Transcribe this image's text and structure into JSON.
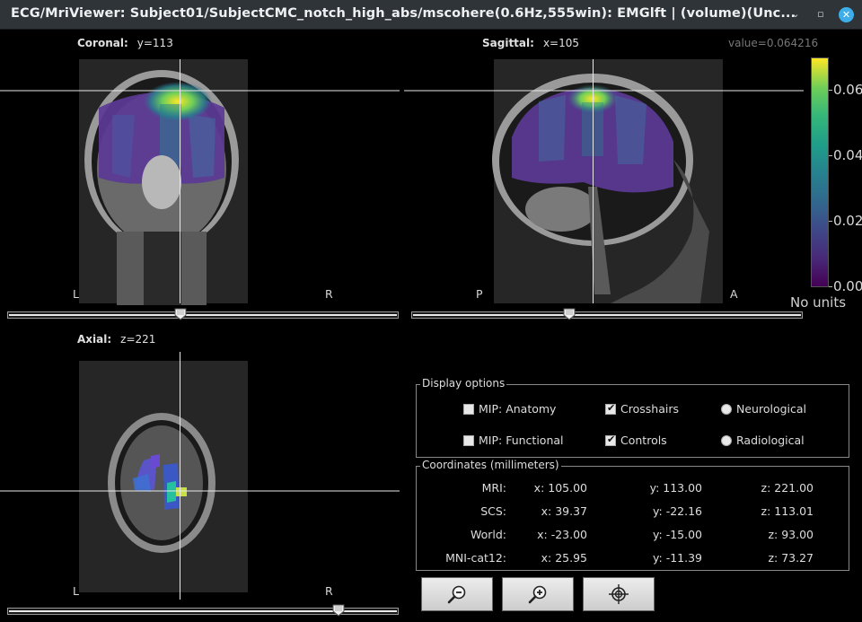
{
  "window": {
    "title": "ECG/MriViewer: Subject01/SubjectCMC_notch_high_abs/mscohere(0.6Hz,555win): EMGlft | (volume)(Unc...",
    "minimize_glyph": "⌄",
    "maximize_glyph": "▫",
    "close_glyph": "✕"
  },
  "views": {
    "coronal": {
      "name": "Coronal:",
      "coord": "y=113",
      "left": "L",
      "right": "R",
      "slider_value": 0.44
    },
    "sagittal": {
      "name": "Sagittal:",
      "coord": "x=105",
      "left": "P",
      "right": "A",
      "slider_value": 0.4
    },
    "axial": {
      "name": "Axial:",
      "coord": "z=221",
      "left": "L",
      "right": "R",
      "slider_value": 0.86
    }
  },
  "value_readout": "value=0.064216",
  "colorbar": {
    "ticks": [
      "0.06",
      "0.04",
      "0.02",
      "0.00"
    ],
    "units": "No units",
    "colors": [
      "#440154",
      "#3e4989",
      "#26828e",
      "#35b779",
      "#fde725"
    ]
  },
  "display_options": {
    "title": "Display options",
    "mip_anatomy": {
      "label": "MIP: Anatomy",
      "checked": false
    },
    "mip_functional": {
      "label": "MIP: Functional",
      "checked": false
    },
    "crosshairs": {
      "label": "Crosshairs",
      "checked": true
    },
    "controls": {
      "label": "Controls",
      "checked": true
    },
    "neurological": {
      "label": "Neurological",
      "selected": false
    },
    "radiological": {
      "label": "Radiological",
      "selected": false
    }
  },
  "coordinates": {
    "title": "Coordinates (millimeters)",
    "rows": [
      {
        "label": "MRI:",
        "x": "x: 105.00",
        "y": "y: 113.00",
        "z": "z: 221.00"
      },
      {
        "label": "SCS:",
        "x": "x: 39.37",
        "y": "y: -22.16",
        "z": "z: 113.01"
      },
      {
        "label": "World:",
        "x": "x: -23.00",
        "y": "y: -15.00",
        "z": "z: 93.00"
      },
      {
        "label": "MNI-cat12:",
        "x": "x: 25.95",
        "y": "y: -11.39",
        "z": "z: 73.27"
      }
    ]
  },
  "buttons": {
    "zoom_out": "zoom-out-icon",
    "zoom_in": "zoom-in-icon",
    "center": "crosshair-target-icon"
  }
}
